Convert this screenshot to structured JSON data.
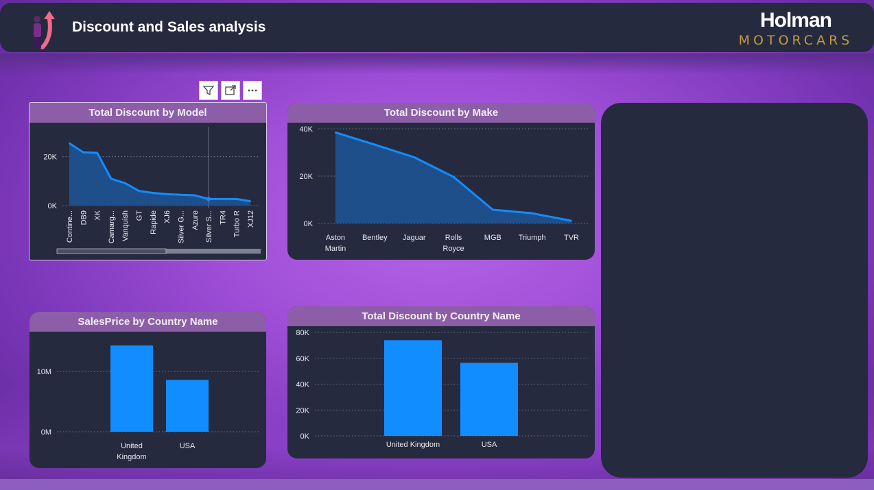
{
  "header": {
    "title": "Discount and Sales analysis",
    "brand_name": "Holman",
    "brand_sub": "MOTORCARS"
  },
  "visual_toolbar": {
    "icons": [
      "filter-icon",
      "focus-mode-icon",
      "more-options-icon"
    ]
  },
  "colors": {
    "series": "#118dff",
    "area": "#1e4f8a",
    "card_bg": "#252a3f",
    "card_header": "#8c5ea8"
  },
  "chart_data": [
    {
      "type": "area",
      "title": "Total Discount by Model",
      "categories": [
        "Contine...",
        "DB9",
        "XK",
        "Camarg...",
        "Vanquish",
        "GT",
        "Rapide",
        "XJ6",
        "Silver G...",
        "Azure",
        "Silver S...",
        "TR4",
        "Turbo R",
        "XJ12"
      ],
      "values": [
        25500,
        21800,
        21600,
        11000,
        9200,
        6000,
        5200,
        4700,
        4400,
        4200,
        2700,
        2700,
        2700,
        1800
      ],
      "yticks": [
        "0K",
        "20K"
      ],
      "ylim": [
        0,
        30000
      ],
      "grid": true
    },
    {
      "type": "area",
      "title": "Total Discount by Make",
      "categories": [
        "Aston Martin",
        "Bentley",
        "Jaguar",
        "Rolls Royce",
        "MGB",
        "Triumph",
        "TVR"
      ],
      "values": [
        38500,
        33300,
        28000,
        19700,
        5800,
        4300,
        1100
      ],
      "yticks": [
        "0K",
        "20K",
        "40K"
      ],
      "ylim": [
        0,
        40000
      ],
      "grid": true
    },
    {
      "type": "bar",
      "title": "SalesPrice by Country Name",
      "categories": [
        "United Kingdom",
        "USA"
      ],
      "values": [
        14300000,
        8600000
      ],
      "yticks": [
        "0M",
        "10M"
      ],
      "ylim": [
        0,
        15000000
      ],
      "grid": true
    },
    {
      "type": "bar",
      "title": "Total Discount by Country Name",
      "categories": [
        "United Kingdom",
        "USA"
      ],
      "values": [
        74000,
        56500
      ],
      "yticks": [
        "0K",
        "20K",
        "40K",
        "60K",
        "80K"
      ],
      "ylim": [
        0,
        80000
      ],
      "grid": true
    }
  ]
}
